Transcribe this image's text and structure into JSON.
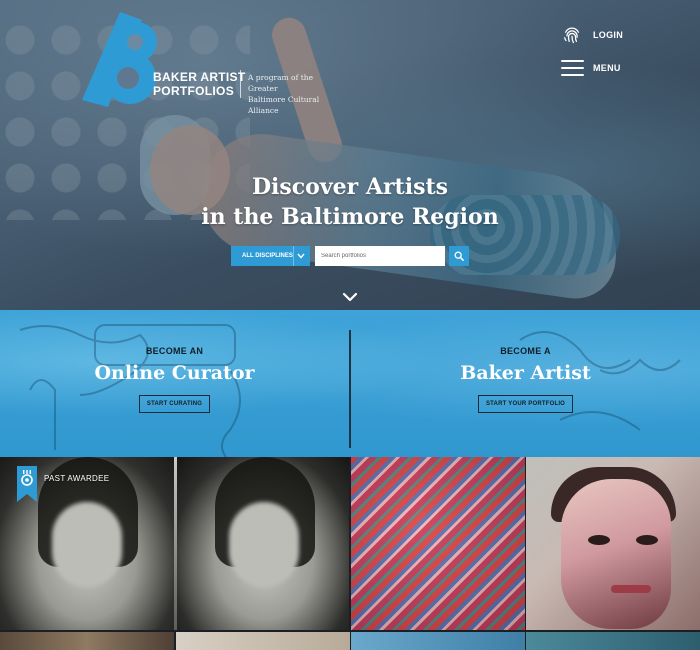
{
  "brand": {
    "name_line1": "BAKER ARTIST",
    "name_line2": "PORTFOLIOS",
    "tagline_line1": "A program of the Greater",
    "tagline_line2": "Baltimore Cultural Alliance",
    "logo_color": "#2f9bd5"
  },
  "nav": {
    "login_label": "LOGIN",
    "menu_label": "MENU",
    "login_icon": "fingerprint-icon",
    "menu_icon": "hamburger-icon"
  },
  "hero": {
    "headline_line1": "Discover Artists",
    "headline_line2": "in the Baltimore Region",
    "discipline_select": "ALL DISCIPLINES",
    "search_placeholder": "Search portfolios",
    "search_icon": "search-icon",
    "scroll_icon": "chevron-down-icon"
  },
  "cta": {
    "left": {
      "eyebrow": "BECOME AN",
      "title": "Online Curator",
      "button": "START CURATING"
    },
    "right": {
      "eyebrow": "BECOME A",
      "title": "Baker Artist",
      "button": "START YOUR PORTFOLIO"
    },
    "accent_color": "#3ea3d8"
  },
  "grid": {
    "award_label": "PAST AWARDEE",
    "award_icon": "ribbon-icon"
  }
}
